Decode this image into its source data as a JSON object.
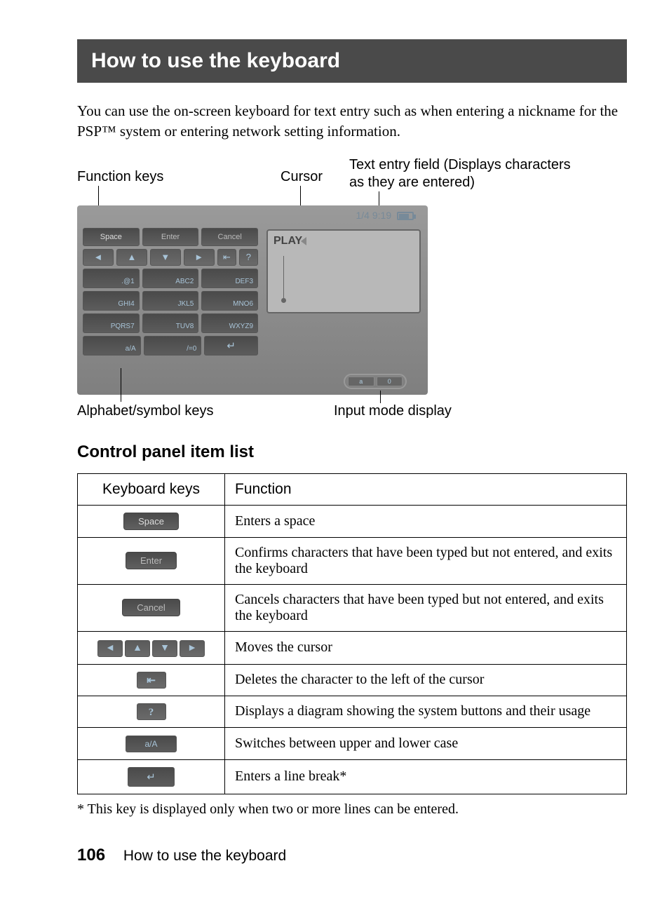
{
  "title": "How to use the keyboard",
  "intro": "You can use the on-screen keyboard for text entry such as when entering a nickname for the PSP™ system or entering network setting information.",
  "diagram": {
    "label_function_keys": "Function keys",
    "label_cursor": "Cursor",
    "label_text_field": "Text entry field (Displays characters as they are entered)",
    "label_alpha_keys": "Alphabet/symbol keys",
    "label_input_mode": "Input mode display",
    "status_time": "1/4 9:19",
    "fn_space": "Space",
    "fn_enter": "Enter",
    "fn_cancel": "Cancel",
    "arrow_left": "◄",
    "arrow_up": "▲",
    "arrow_down": "▼",
    "arrow_right": "►",
    "backspace_glyph": "⇤",
    "help_glyph": "?",
    "keys_r1": [
      ".@1",
      "ABC2",
      "DEF3"
    ],
    "keys_r2": [
      "GHI4",
      "JKL5",
      "MNO6"
    ],
    "keys_r3": [
      "PQRS7",
      "TUV8",
      "WXYZ9"
    ],
    "keys_r4": [
      "a/A",
      "/=0",
      "↵"
    ],
    "text_field_value": "PLAY",
    "mode_a": "a",
    "mode_0": "0"
  },
  "section_heading": "Control panel item list",
  "table": {
    "col1": "Keyboard keys",
    "col2": "Function",
    "rows": [
      {
        "key_label": "Space",
        "desc": "Enters a space"
      },
      {
        "key_label": "Enter",
        "desc": "Confirms characters that have been typed but not entered, and exits the keyboard"
      },
      {
        "key_label": "Cancel",
        "desc": "Cancels characters that have been typed but not entered, and exits the keyboard"
      },
      {
        "desc": "Moves the cursor"
      },
      {
        "key_label": "⇤",
        "desc": "Deletes the character to the left of the cursor"
      },
      {
        "key_label": "?",
        "desc": "Displays a diagram showing the system buttons and their usage"
      },
      {
        "key_label": "a/A",
        "desc": "Switches between upper and lower case"
      },
      {
        "key_label": "↵",
        "desc": "Enters a line break*"
      }
    ]
  },
  "footnote": "* This key is displayed only when two or more lines can be entered.",
  "footer": {
    "page": "106",
    "title": "How to use the keyboard"
  }
}
